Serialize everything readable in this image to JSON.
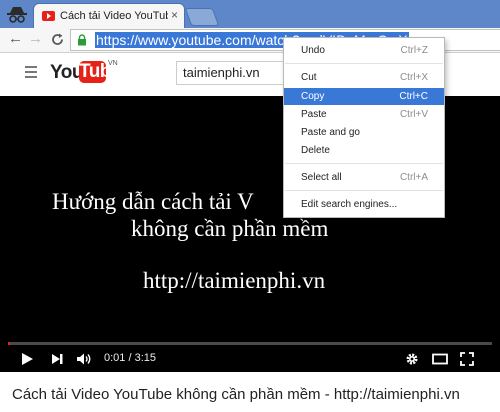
{
  "browser": {
    "tab_title": "Cách tải Video YouTube k",
    "tab_close": "×",
    "url": "https://www.youtube.com/watch?v=dVIDgMmQwX"
  },
  "youtube": {
    "logo_you": "You",
    "logo_tube": "Tube",
    "logo_region": "VN",
    "search_value": "taimienphi.vn"
  },
  "video": {
    "line1": "Hướng dẫn cách tải V",
    "line2": "không cần phần mềm",
    "line3": "http://taimienphi.vn",
    "time": "0:01 / 3:15",
    "progress_fraction": 0.005
  },
  "video_title": "Cách tải Video YouTube không cần phần mềm - http://taimienphi.vn",
  "context_menu": {
    "items": [
      {
        "label": "Undo",
        "shortcut": "Ctrl+Z"
      },
      {
        "label": "Cut",
        "shortcut": "Ctrl+X"
      },
      {
        "label": "Copy",
        "shortcut": "Ctrl+C",
        "highlighted": true
      },
      {
        "label": "Paste",
        "shortcut": "Ctrl+V"
      },
      {
        "label": "Paste and go",
        "shortcut": ""
      },
      {
        "label": "Delete",
        "shortcut": ""
      },
      {
        "label": "Select all",
        "shortcut": "Ctrl+A"
      },
      {
        "label": "Edit search engines...",
        "shortcut": ""
      }
    ]
  },
  "colors": {
    "tab_strip": "#5d87c9",
    "selection": "#3a78d8",
    "youtube_red": "#e62117"
  }
}
